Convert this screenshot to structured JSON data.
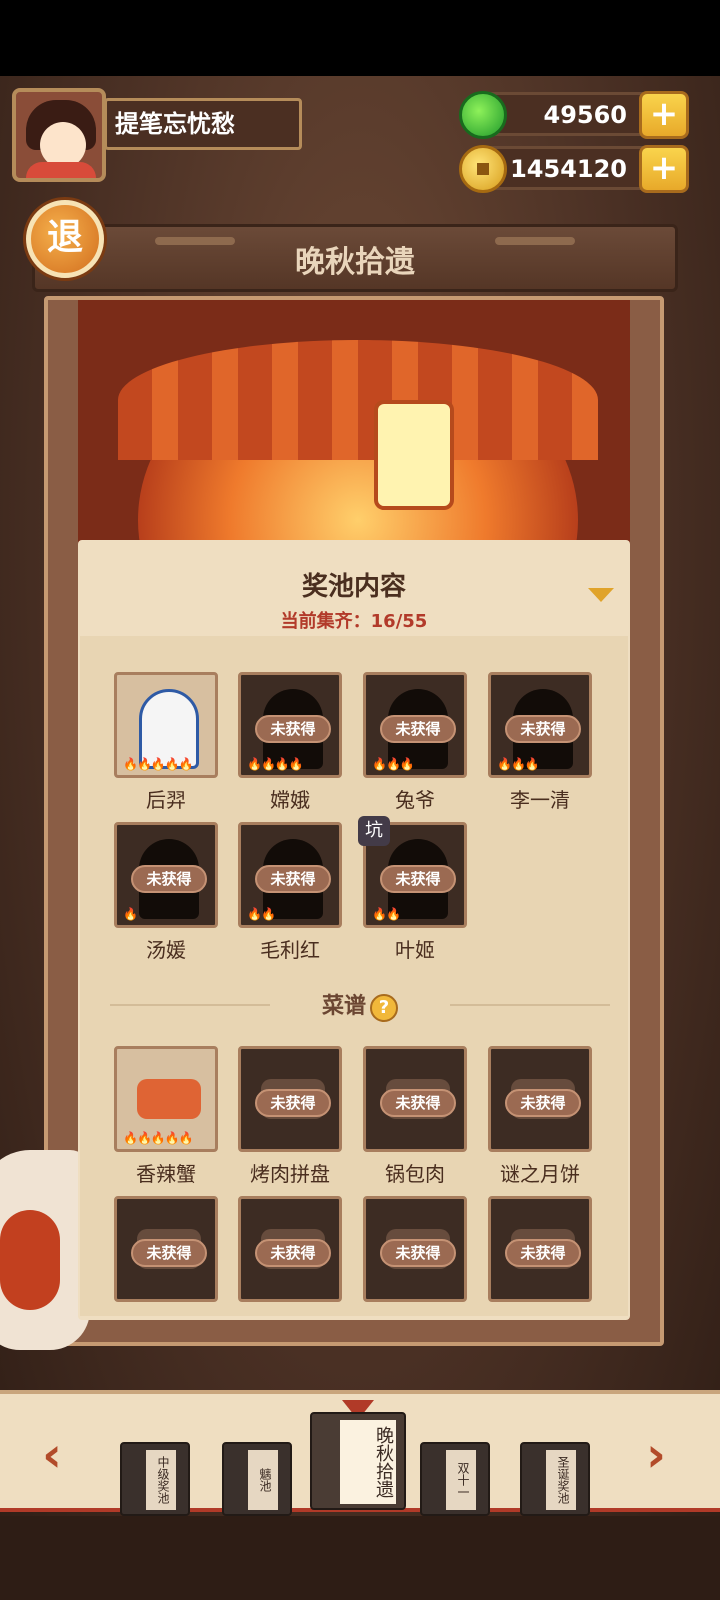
{
  "player": {
    "name": "提笔忘忧愁"
  },
  "resources": {
    "jade": {
      "icon": "jade-icon",
      "value": "49560"
    },
    "coin": {
      "icon": "coin-icon",
      "value": "1454120"
    },
    "plus_label": "+"
  },
  "back_label": "退",
  "page_title": "晚秋拾遗",
  "pool": {
    "title": "奖池内容",
    "count_label": "当前集齐：16/55",
    "characters": [
      {
        "name": "后羿",
        "obtained": true,
        "flames": "🔥🔥🔥🔥🔥"
      },
      {
        "name": "嫦娥",
        "obtained": false,
        "flames": "🔥🔥🔥🔥"
      },
      {
        "name": "兔爷",
        "obtained": false,
        "flames": "🔥🔥🔥"
      },
      {
        "name": "李一清",
        "obtained": false,
        "flames": "🔥🔥🔥"
      },
      {
        "name": "汤媛",
        "obtained": false,
        "flames": "🔥"
      },
      {
        "name": "毛利红",
        "obtained": false,
        "flames": "🔥🔥"
      },
      {
        "name": "叶姬",
        "obtained": false,
        "flames": "🔥🔥"
      }
    ],
    "locked_label": "未获得",
    "pit_badge": "坑",
    "recipes_section": "菜谱",
    "recipes": [
      {
        "name": "香辣蟹",
        "obtained": true,
        "flames": "🔥🔥🔥🔥🔥"
      },
      {
        "name": "烤肉拼盘",
        "obtained": false,
        "flames": ""
      },
      {
        "name": "锅包肉",
        "obtained": false,
        "flames": ""
      },
      {
        "name": "谜之月饼",
        "obtained": false,
        "flames": ""
      },
      {
        "name": "",
        "obtained": false,
        "flames": ""
      },
      {
        "name": "",
        "obtained": false,
        "flames": ""
      },
      {
        "name": "",
        "obtained": false,
        "flames": ""
      },
      {
        "name": "",
        "obtained": false,
        "flames": ""
      }
    ]
  },
  "tabs": [
    {
      "label": "中级奖池",
      "active": false
    },
    {
      "label": "魑池",
      "active": false
    },
    {
      "label": "晚秋拾遗",
      "active": true
    },
    {
      "label": "双十一",
      "active": false
    },
    {
      "label": "圣诞奖池",
      "active": false
    }
  ],
  "nav": {
    "prev": "‹",
    "next": "›"
  }
}
